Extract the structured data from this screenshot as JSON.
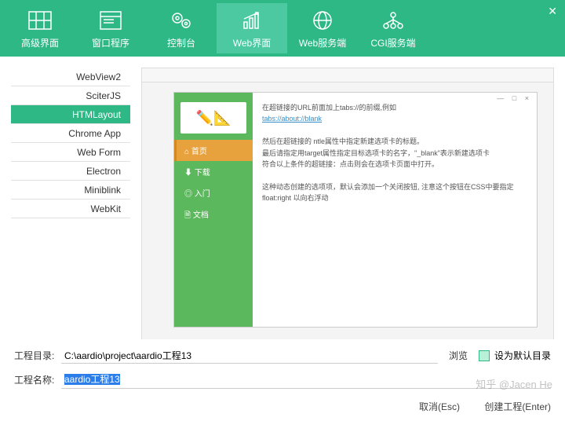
{
  "tabs": [
    {
      "label": "高级界面"
    },
    {
      "label": "窗口程序"
    },
    {
      "label": "控制台"
    },
    {
      "label": "Web界面"
    },
    {
      "label": "Web服务端"
    },
    {
      "label": "CGI服务端"
    }
  ],
  "side": [
    "WebView2",
    "SciterJS",
    "HTMLayout",
    "Chrome App",
    "Web Form",
    "Electron",
    "Miniblink",
    "WebKit"
  ],
  "preview": {
    "menu": [
      {
        "icon": "⌂",
        "label": "首页"
      },
      {
        "icon": "⬇",
        "label": "下载"
      },
      {
        "icon": "◎",
        "label": "入门"
      },
      {
        "icon": "🗎",
        "label": "文档"
      }
    ],
    "body": {
      "l1": "在超链接的URL前面加上tabs://的前缀,例如",
      "link": "tabs://about://blank",
      "l2": "然后在超链接的 ntle属性中指定新建选项卡的标题。",
      "l3": "最后请指定用target属性指定目标选项卡的名字，\"_blank\"表示新建选项卡",
      "l4": "符合以上条件的超链接：点击则会在选项卡页面中打开。",
      "l5": "这种动态创建的选项项，默认会添加一个关闭按钮, 注意这个按钮在CSS中要指定 float:right 以向右浮动"
    }
  },
  "form": {
    "dirLabel": "工程目录:",
    "dirValue": "C:\\aardio\\project\\aardio工程13",
    "nameLabel": "工程名称:",
    "nameValue": "aardio工程13",
    "browse": "浏览",
    "setDefault": "设为默认目录",
    "cancel": "取消(Esc)",
    "create": "创建工程(Enter)"
  },
  "watermark": "知乎 @Jacen He"
}
